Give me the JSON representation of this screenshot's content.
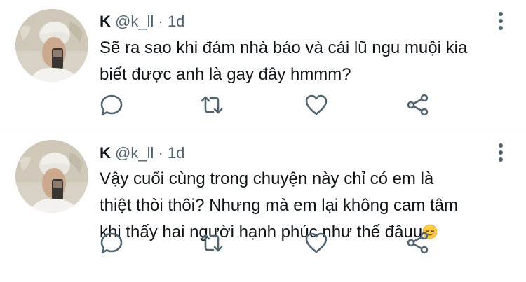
{
  "tweets": [
    {
      "author_name": "K",
      "handle": "@k_ll",
      "separator": "·",
      "time": "1d",
      "text_lines": [
        "Sẽ ra sao khi đám nhà báo và cái lũ ngu muội kia",
        "biết được anh là gay đây hmmm?"
      ],
      "emoji": ""
    },
    {
      "author_name": "K",
      "handle": "@k_ll",
      "separator": "·",
      "time": "1d",
      "text_lines": [
        "Vậy cuối cùng trong chuyện này chỉ có em là",
        "thiệt thòi thôi? Nhưng mà em lại không cam tâm",
        "khi thấy hai người hạnh phúc như thế đâuu"
      ],
      "emoji": "relieved-face"
    }
  ],
  "icons": {
    "reply": "reply-icon",
    "retweet": "retweet-icon",
    "like": "heart-icon",
    "share": "share-icon",
    "more": "more-vertical-icon"
  },
  "colors": {
    "text": "#0f1419",
    "secondary": "#536471",
    "divider": "#e6e9ec",
    "icon": "#536471"
  }
}
